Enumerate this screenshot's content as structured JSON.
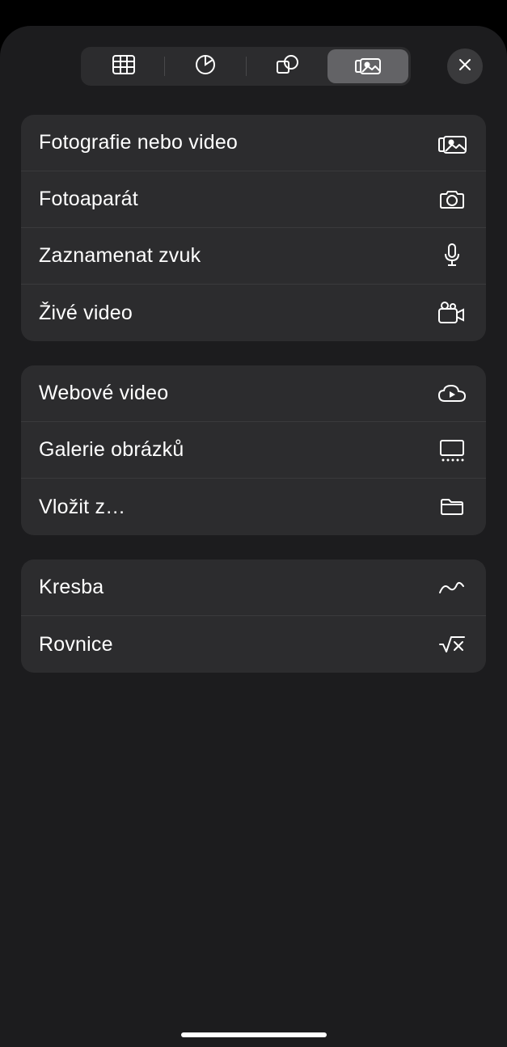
{
  "toolbar": {
    "tabs": [
      {
        "name": "table"
      },
      {
        "name": "chart"
      },
      {
        "name": "shape"
      },
      {
        "name": "media",
        "active": true
      }
    ]
  },
  "groups": [
    {
      "items": [
        {
          "label": "Fotografie nebo video",
          "icon": "photos-icon",
          "name": "photo-or-video"
        },
        {
          "label": "Fotoaparát",
          "icon": "camera-icon",
          "name": "camera"
        },
        {
          "label": "Zaznamenat zvuk",
          "icon": "microphone-icon",
          "name": "record-audio"
        },
        {
          "label": "Živé video",
          "icon": "video-camera-icon",
          "name": "live-video"
        }
      ]
    },
    {
      "items": [
        {
          "label": "Webové video",
          "icon": "cloud-play-icon",
          "name": "web-video"
        },
        {
          "label": "Galerie obrázků",
          "icon": "gallery-icon",
          "name": "image-gallery"
        },
        {
          "label": "Vložit z…",
          "icon": "folder-icon",
          "name": "insert-from"
        }
      ]
    },
    {
      "items": [
        {
          "label": "Kresba",
          "icon": "scribble-icon",
          "name": "drawing"
        },
        {
          "label": "Rovnice",
          "icon": "equation-icon",
          "name": "equation"
        }
      ]
    }
  ]
}
